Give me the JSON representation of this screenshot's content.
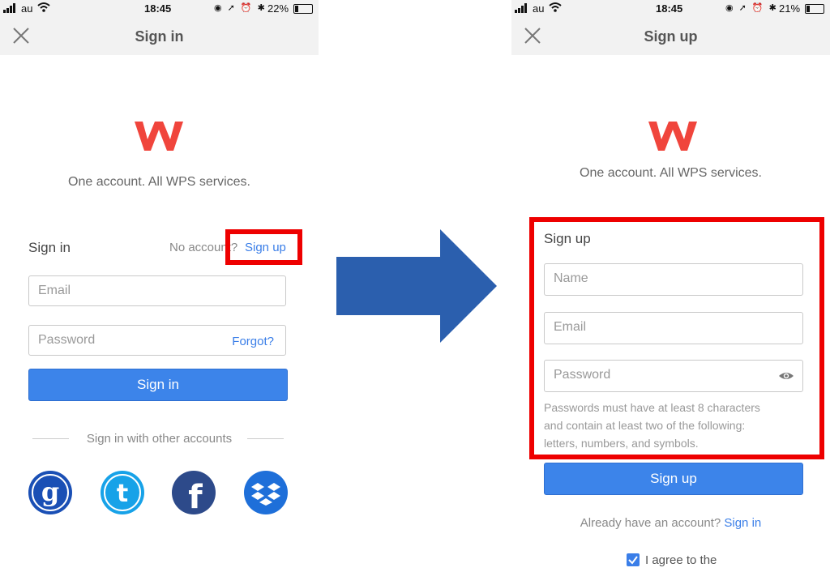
{
  "left": {
    "status": {
      "carrier": "au",
      "time": "18:45",
      "battery": "22%"
    },
    "nav_title": "Sign in",
    "tagline": "One account. All WPS services.",
    "section_title": "Sign in",
    "no_account_text": "No account?",
    "signup_link": "Sign up",
    "email_placeholder": "Email",
    "password_placeholder": "Password",
    "forgot_link": "Forgot?",
    "signin_button": "Sign in",
    "other_accounts": "Sign in with other accounts",
    "social": [
      "google-icon",
      "twitter-icon",
      "facebook-icon",
      "dropbox-icon"
    ]
  },
  "right": {
    "status": {
      "carrier": "au",
      "time": "18:45",
      "battery": "21%"
    },
    "nav_title": "Sign up",
    "tagline": "One account. All WPS services.",
    "section_title": "Sign up",
    "name_placeholder": "Name",
    "email_placeholder": "Email",
    "password_placeholder": "Password",
    "password_hint_1": "Passwords must have at least 8 characters",
    "password_hint_2": "and contain at least two of the following:",
    "password_hint_3": "letters, numbers, and symbols.",
    "signup_button": "Sign up",
    "have_account_text": "Already have an account?",
    "signin_link": "Sign in",
    "agree_text": "I agree to the",
    "agree_checked": true
  },
  "colors": {
    "accent_blue": "#3c84ea",
    "link_blue": "#3a7ee8",
    "highlight_red": "#ee0000",
    "arrow_blue": "#2b5fae",
    "logo_red": "#f0453c"
  }
}
